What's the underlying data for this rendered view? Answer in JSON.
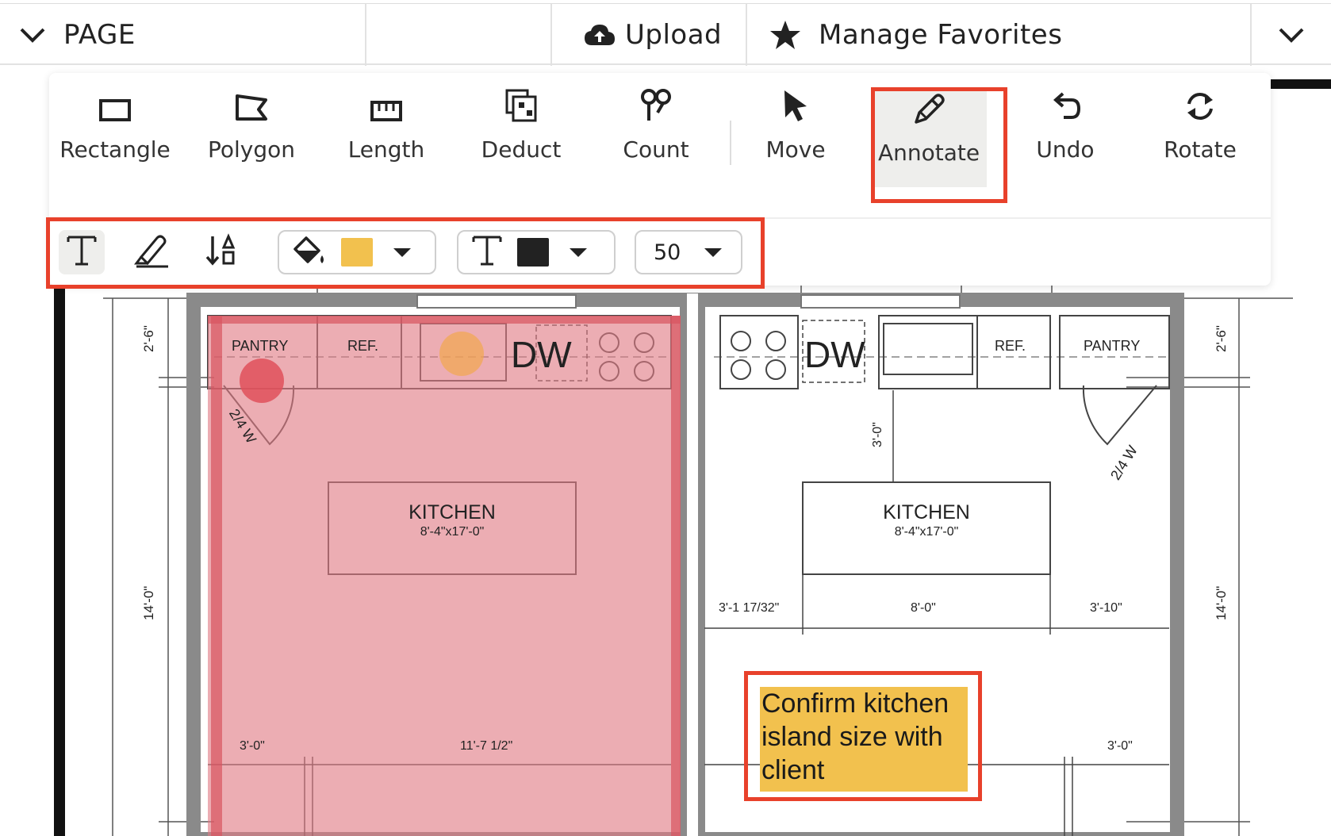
{
  "topbar": {
    "page_label": "PAGE",
    "upload_label": "Upload",
    "favorites_label": "Manage Favorites"
  },
  "tools": [
    {
      "label": "Rectangle",
      "icon": "rectangle-icon"
    },
    {
      "label": "Polygon",
      "icon": "polygon-icon"
    },
    {
      "label": "Length",
      "icon": "ruler-icon"
    },
    {
      "label": "Deduct",
      "icon": "deduct-icon"
    },
    {
      "label": "Count",
      "icon": "count-icon"
    },
    {
      "label": "Move",
      "icon": "cursor-icon"
    },
    {
      "label": "Annotate",
      "icon": "pen-icon",
      "active": true
    },
    {
      "label": "Undo",
      "icon": "undo-icon"
    },
    {
      "label": "Rotate",
      "icon": "rotate-icon"
    }
  ],
  "annotate_options": {
    "fill_color": "#f2c14e",
    "text_color": "#222222",
    "font_size": "50"
  },
  "plan": {
    "left": {
      "pantry": "PANTRY",
      "ref": "REF.",
      "dw": "DW",
      "door": "2/4 W",
      "kitchen": "KITCHEN",
      "kitchen_dims": "8'-4\"x17'-0\"",
      "dim_top": "2'-6\"",
      "dim_side": "14'-0\"",
      "dim_bottom_a": "3'-0\"",
      "dim_bottom_b": "11'-7 1/2\""
    },
    "right": {
      "pantry": "PANTRY",
      "ref": "REF.",
      "dw": "DW",
      "door": "2/4 W",
      "kitchen": "KITCHEN",
      "kitchen_dims": "8'-4\"x17'-0\"",
      "dim_top": "2'-6\"",
      "dim_side": "14'-0\"",
      "dim_vert": "3'-0\"",
      "dim_a": "3'-1 17/32\"",
      "dim_b": "8'-0\"",
      "dim_c": "3'-10\"",
      "dim_bottom": "3'-0\""
    },
    "note": "Confirm kitchen island size with client"
  },
  "colors": {
    "highlight": "#e8412b",
    "area_fill": "#e07a85",
    "note_fill": "#f2c14e"
  }
}
